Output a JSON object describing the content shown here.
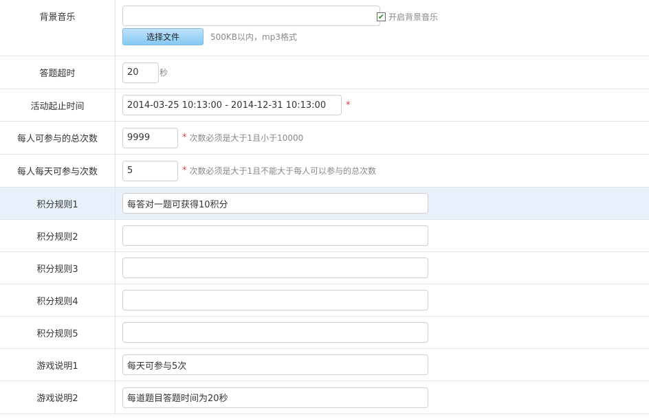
{
  "rows": {
    "bgm": {
      "label": "背景音乐",
      "value": "",
      "checkbox_checked": true,
      "checkbox_label": "开启背景音乐",
      "file_button": "选择文件",
      "file_hint": "500KB以内，mp3格式"
    },
    "timeout": {
      "label": "答题超时",
      "value": "20",
      "unit": "秒"
    },
    "period": {
      "label": "活动起止时间",
      "value": "2014-03-25 10:13:00 - 2014-12-31 10:13:00",
      "required": "*"
    },
    "total": {
      "label": "每人可参与的总次数",
      "value": "9999",
      "required": "*",
      "hint": "次数必须是大于1且小于10000"
    },
    "daily": {
      "label": "每人每天可参与次数",
      "value": "5",
      "required": "*",
      "hint": "次数必须是大于1且不能大于每人可以参与的总次数"
    },
    "rule1": {
      "label": "积分规则1",
      "value": "每答对一题可获得10积分"
    },
    "rule2": {
      "label": "积分规则2",
      "value": ""
    },
    "rule3": {
      "label": "积分规则3",
      "value": ""
    },
    "rule4": {
      "label": "积分规则4",
      "value": ""
    },
    "rule5": {
      "label": "积分规则5",
      "value": ""
    },
    "desc1": {
      "label": "游戏说明1",
      "value": "每天可参与5次"
    },
    "desc2": {
      "label": "游戏说明2",
      "value": "每道题目答题时间为20秒"
    }
  }
}
